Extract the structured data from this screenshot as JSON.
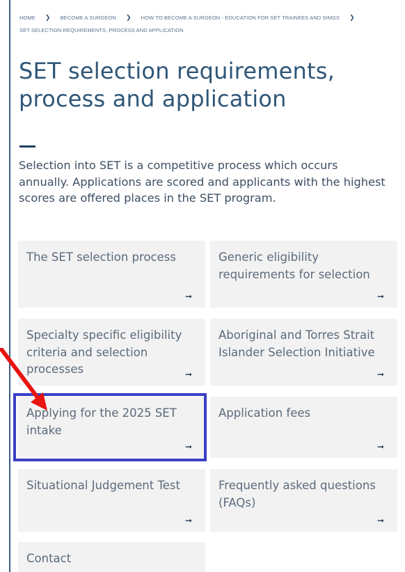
{
  "breadcrumb": {
    "items": [
      "HOME",
      "BECOME A SURGEON",
      "HOW TO BECOME A SURGEON - EDUCATION FOR SET TRAINEES AND SIMGS",
      "SET SELECTION REQUIREMENTS, PROCESS AND APPLICATION"
    ],
    "separator": "❯"
  },
  "page": {
    "title": "SET selection requirements, process and application",
    "intro": "Selection into SET is a competitive process which occurs annually. Applications are scored and applicants with the highest scores are offered places in the SET program."
  },
  "cards": [
    {
      "label": "The SET selection process",
      "arrow": "➞"
    },
    {
      "label": "Generic eligibility requirements for selection",
      "arrow": "➞"
    },
    {
      "label": "Specialty specific eligibility criteria and selection processes",
      "arrow": "➞"
    },
    {
      "label": "Aboriginal and Torres Strait Islander Selection Initiative",
      "arrow": "➞"
    },
    {
      "label": "Applying for the 2025 SET intake",
      "arrow": "➞"
    },
    {
      "label": "Application fees",
      "arrow": "➞"
    },
    {
      "label": "Situational Judgement Test",
      "arrow": "➞"
    },
    {
      "label": "Frequently asked questions (FAQs)",
      "arrow": "➞"
    },
    {
      "label": "Contact",
      "arrow": ""
    }
  ],
  "annotations": {
    "highlight_color": "#3a40c6",
    "pointer_color": "#e8140f"
  }
}
